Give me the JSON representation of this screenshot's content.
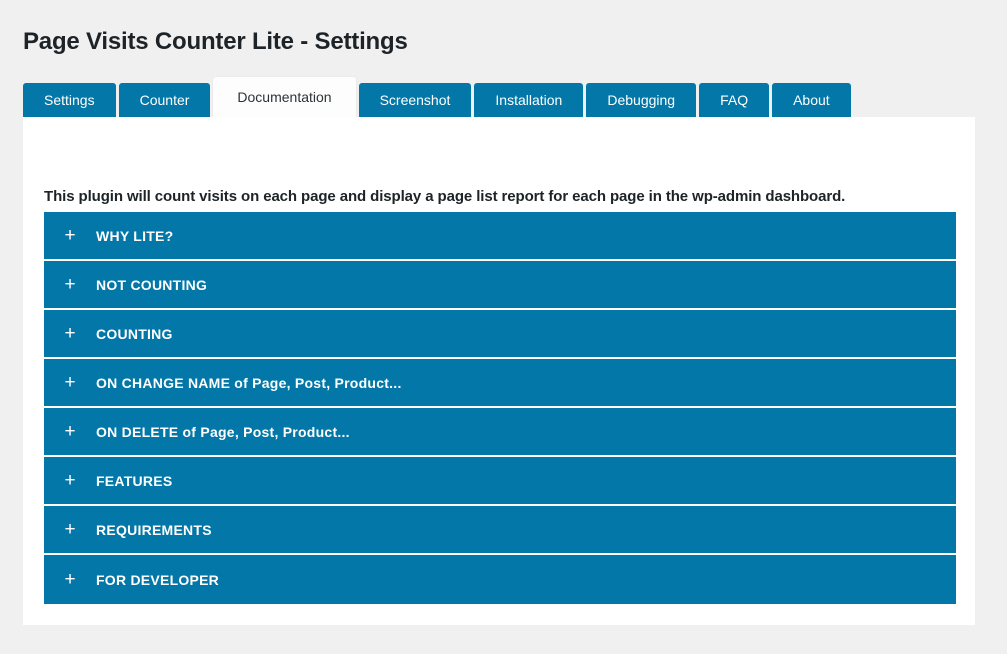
{
  "page": {
    "title": "Page Visits Counter Lite - Settings",
    "background_color": "#f0f0f1",
    "accent_color": "#0277a8"
  },
  "tabs": [
    {
      "label": "Settings",
      "active": false
    },
    {
      "label": "Counter",
      "active": false
    },
    {
      "label": "Documentation",
      "active": true
    },
    {
      "label": "Screenshot",
      "active": false
    },
    {
      "label": "Installation",
      "active": false
    },
    {
      "label": "Debugging",
      "active": false
    },
    {
      "label": "FAQ",
      "active": false
    },
    {
      "label": "About",
      "active": false
    }
  ],
  "documentation": {
    "intro": "This plugin will count visits on each page and display a page list report for each page in the wp-admin dashboard.",
    "expand_icon": "+",
    "sections": [
      {
        "label": "WHY LITE?"
      },
      {
        "label": "NOT COUNTING"
      },
      {
        "label": "COUNTING"
      },
      {
        "label": "ON CHANGE NAME of Page, Post, Product..."
      },
      {
        "label": "ON DELETE of Page, Post, Product..."
      },
      {
        "label": "FEATURES"
      },
      {
        "label": "REQUIREMENTS"
      },
      {
        "label": "FOR DEVELOPER"
      }
    ]
  }
}
